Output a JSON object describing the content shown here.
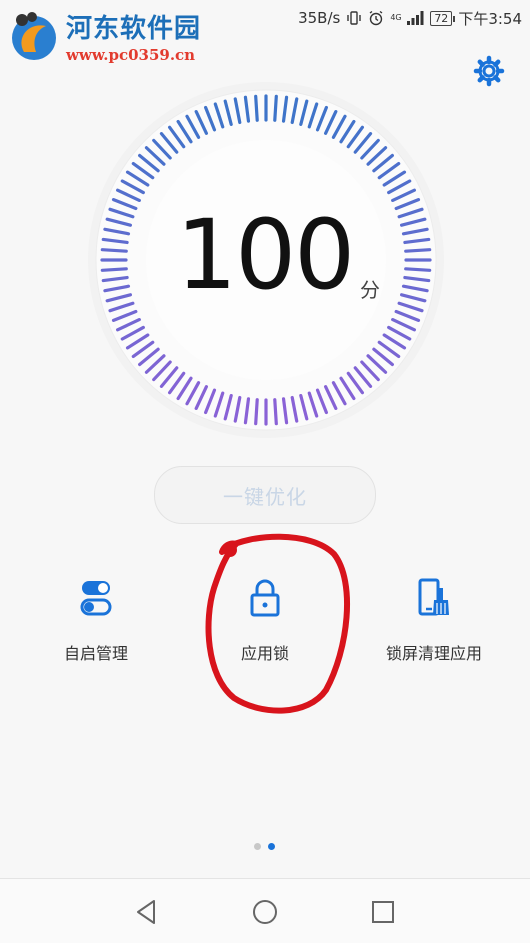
{
  "status_bar": {
    "watermark_title": "河东软件园",
    "watermark_url": "www.pc0359.cn",
    "net_speed": "35B/s",
    "signal_label": "4G",
    "battery": "72",
    "time": "下午3:54"
  },
  "icons": {
    "settings": "gear-icon",
    "back": "back-triangle-icon",
    "home": "home-circle-icon",
    "recents": "recents-square-icon"
  },
  "score": {
    "value": "100",
    "unit": "分"
  },
  "optimize_button": {
    "label": "一键优化"
  },
  "tools": [
    {
      "label": "自启管理",
      "icon": "toggle-switches-icon"
    },
    {
      "label": "应用锁",
      "icon": "lock-icon"
    },
    {
      "label": "锁屏清理应用",
      "icon": "phone-broom-icon"
    }
  ],
  "pager": {
    "pages": 2,
    "active": 2
  },
  "colors": {
    "accent": "#1a73d9",
    "gauge_top": "#3e74c9",
    "gauge_bottom": "#8a62d6",
    "annotation": "#d8141c",
    "button_text": "#c9d6e6"
  }
}
